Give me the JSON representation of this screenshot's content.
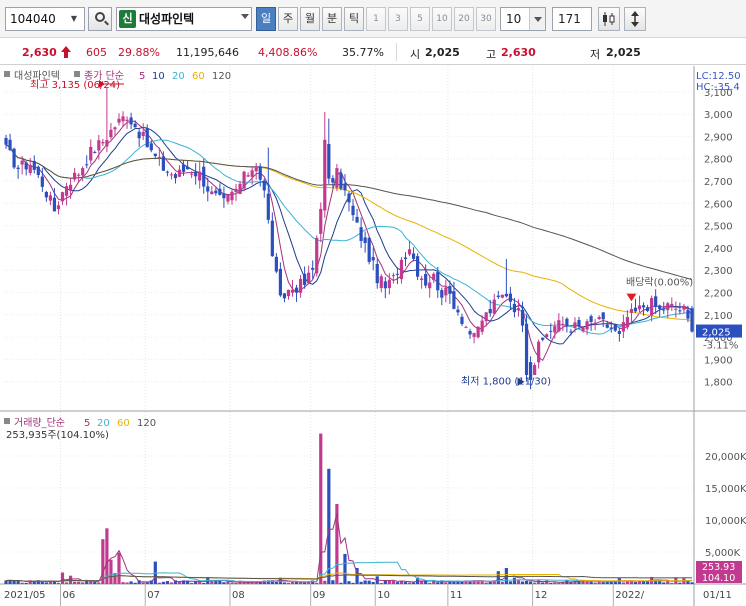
{
  "toolbar": {
    "code": "104040",
    "credit_badge": "신",
    "stock_name": "대성파인텍",
    "period_tabs": [
      "일",
      "주",
      "월",
      "분",
      "틱"
    ],
    "active_tab": "일",
    "interval_tabs": [
      "1",
      "3",
      "5",
      "10",
      "20",
      "30"
    ],
    "period_value": "10",
    "count_value": "171"
  },
  "quote": {
    "price": "2,630",
    "change": "605",
    "change_pct": "29.88%",
    "volume": "11,195,646",
    "volume_ratio": "4,408.86%",
    "turnover_pct": "35.77%",
    "open_label": "시",
    "open": "2,025",
    "high_label": "고",
    "high": "2,630",
    "low_label": "저",
    "low": "2,025",
    "colors": {
      "up": "#c8102e",
      "down": "#2b4fbf"
    }
  },
  "chart_data": [
    {
      "type": "candlestick",
      "name": "price",
      "legend": {
        "stock": "대성파인텍",
        "indicator": "종가 단순",
        "periods": [
          "5",
          "10",
          "20",
          "60",
          "120"
        ],
        "colors": [
          "#a0337a",
          "#1f3d8f",
          "#3bb3d6",
          "#e8b200",
          "#555555"
        ]
      },
      "ylim": [
        1700,
        3180
      ],
      "yticks": [
        1800,
        1900,
        2000,
        2100,
        2200,
        2300,
        2400,
        2500,
        2600,
        2700,
        2800,
        2900,
        3000,
        3100
      ],
      "ytick_labels": [
        "1,800",
        "1,900",
        "2,000",
        "2,100",
        "2,200",
        "2,300",
        "2,400",
        "2,500",
        "2,600",
        "2,700",
        "2,800",
        "2,900",
        "3,000",
        "3,100"
      ],
      "corner_labels": [
        "LC:12.50",
        "HC:-35.4"
      ],
      "current_label": "2,025",
      "current_change": "-3.11%",
      "annotations": {
        "high": "최고 3,135 (06/24)",
        "low": "최저 1,800 (11/30)",
        "dividend": "배당락(0.00%)"
      },
      "xaxis": [
        "2021/05",
        "06",
        "07",
        "08",
        "09",
        "10",
        "11",
        "12",
        "2022/",
        "01/11"
      ],
      "month_index": [
        0,
        14,
        35,
        56,
        76,
        92,
        110,
        131,
        151
      ],
      "n_days": 171,
      "close_anchors": [
        [
          0,
          2840
        ],
        [
          3,
          2760
        ],
        [
          6,
          2780
        ],
        [
          9,
          2690
        ],
        [
          12,
          2570
        ],
        [
          15,
          2690
        ],
        [
          18,
          2740
        ],
        [
          21,
          2830
        ],
        [
          24,
          2880
        ],
        [
          27,
          2950
        ],
        [
          30,
          3000
        ],
        [
          33,
          2920
        ],
        [
          36,
          2830
        ],
        [
          39,
          2760
        ],
        [
          42,
          2720
        ],
        [
          45,
          2760
        ],
        [
          48,
          2730
        ],
        [
          51,
          2640
        ],
        [
          54,
          2600
        ],
        [
          57,
          2660
        ],
        [
          60,
          2740
        ],
        [
          62,
          2780
        ],
        [
          64,
          2650
        ],
        [
          66,
          2380
        ],
        [
          68,
          2160
        ],
        [
          70,
          2210
        ],
        [
          72,
          2230
        ],
        [
          74,
          2240
        ],
        [
          76,
          2300
        ],
        [
          78,
          2600
        ],
        [
          79,
          2870
        ],
        [
          80,
          2690
        ],
        [
          82,
          2730
        ],
        [
          84,
          2650
        ],
        [
          86,
          2540
        ],
        [
          88,
          2450
        ],
        [
          90,
          2360
        ],
        [
          92,
          2270
        ],
        [
          94,
          2220
        ],
        [
          96,
          2260
        ],
        [
          98,
          2350
        ],
        [
          100,
          2410
        ],
        [
          102,
          2300
        ],
        [
          104,
          2250
        ],
        [
          106,
          2270
        ],
        [
          108,
          2200
        ],
        [
          110,
          2190
        ],
        [
          112,
          2120
        ],
        [
          114,
          2050
        ],
        [
          116,
          1990
        ],
        [
          118,
          2080
        ],
        [
          120,
          2120
        ],
        [
          122,
          2170
        ],
        [
          124,
          2200
        ],
        [
          126,
          2140
        ],
        [
          128,
          2080
        ],
        [
          129,
          1940
        ],
        [
          130,
          1830
        ],
        [
          132,
          1950
        ],
        [
          134,
          2020
        ],
        [
          136,
          2050
        ],
        [
          138,
          2060
        ],
        [
          140,
          2050
        ],
        [
          142,
          2040
        ],
        [
          144,
          2050
        ],
        [
          146,
          2070
        ],
        [
          148,
          2060
        ],
        [
          150,
          2040
        ],
        [
          152,
          2000
        ],
        [
          154,
          2090
        ],
        [
          156,
          2110
        ],
        [
          158,
          2140
        ],
        [
          160,
          2150
        ],
        [
          162,
          2120
        ],
        [
          164,
          2140
        ],
        [
          166,
          2130
        ],
        [
          168,
          2120
        ],
        [
          170,
          2025
        ]
      ],
      "spikes": [
        [
          25,
          3120
        ],
        [
          65,
          2850
        ],
        [
          79,
          3010
        ],
        [
          80,
          2980
        ],
        [
          124,
          2350
        ]
      ]
    },
    {
      "type": "bar",
      "name": "volume",
      "legend": {
        "label": "거래량_단순",
        "periods": [
          "5",
          "20",
          "60",
          "120"
        ],
        "colors": [
          "#a0337a",
          "#3bb3d6",
          "#e8b200",
          "#555555"
        ]
      },
      "summary": "253,935주(104.10%)",
      "ylim": [
        0,
        25000000
      ],
      "yticks": [
        5000000,
        10000000,
        15000000,
        20000000
      ],
      "ytick_labels": [
        "5,000K",
        "10,000K",
        "15,000K",
        "20,000K"
      ],
      "current_labels": [
        "253.93",
        "104.10"
      ],
      "spikes": [
        [
          14,
          1800000
        ],
        [
          16,
          1300000
        ],
        [
          24,
          7000000
        ],
        [
          25,
          8700000
        ],
        [
          26,
          3800000
        ],
        [
          27,
          1700000
        ],
        [
          28,
          4900000
        ],
        [
          37,
          3500000
        ],
        [
          50,
          1100000
        ],
        [
          68,
          1000000
        ],
        [
          78,
          23500000
        ],
        [
          80,
          18000000
        ],
        [
          82,
          12500000
        ],
        [
          84,
          4700000
        ],
        [
          87,
          2500000
        ],
        [
          92,
          1200000
        ],
        [
          102,
          1000000
        ],
        [
          122,
          2000000
        ],
        [
          124,
          2500000
        ],
        [
          126,
          1000000
        ],
        [
          152,
          900000
        ],
        [
          160,
          1100000
        ],
        [
          166,
          1000000
        ],
        [
          168,
          900000
        ]
      ]
    }
  ]
}
